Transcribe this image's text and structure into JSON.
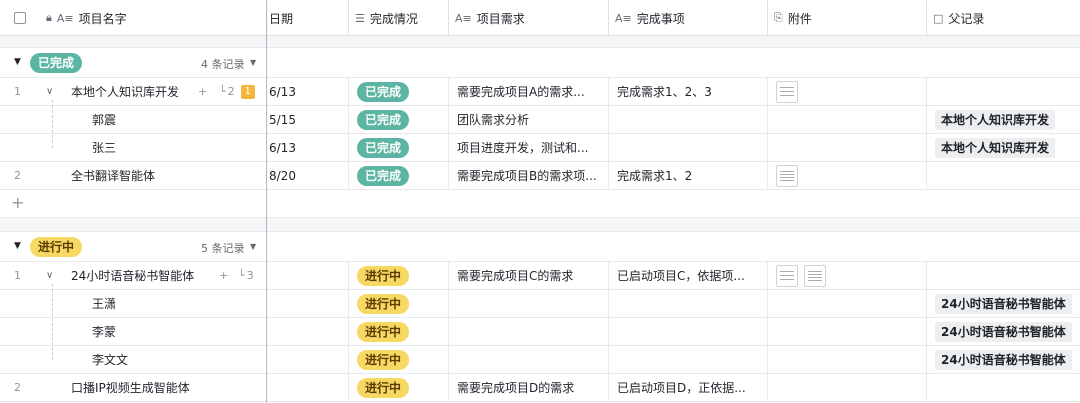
{
  "columns": {
    "name": "项目名字",
    "date": "日期",
    "status": "完成情况",
    "requirement": "项目需求",
    "done_items": "完成事项",
    "attachment": "附件",
    "parent": "父记录"
  },
  "groups": [
    {
      "label": "已完成",
      "count": "4 条记录",
      "rows": [
        {
          "num": "1",
          "name": "本地个人知识库开发",
          "sub_count": "2",
          "badge": "1",
          "date": "6/13",
          "status": "已完成",
          "requirement": "需要完成项目A的需求...",
          "done_items": "完成需求1、2、3",
          "parent": ""
        },
        {
          "num": "",
          "name": "郭震",
          "date": "5/15",
          "status": "已完成",
          "requirement": "团队需求分析",
          "done_items": "",
          "parent": "本地个人知识库开发"
        },
        {
          "num": "",
          "name": "张三",
          "date": "6/13",
          "status": "已完成",
          "requirement": "项目进度开发，测试和...",
          "done_items": "",
          "parent": "本地个人知识库开发"
        },
        {
          "num": "2",
          "name": "全书翻译智能体",
          "date": "8/20",
          "status": "已完成",
          "requirement": "需要完成项目B的需求项...",
          "done_items": "完成需求1、2",
          "parent": ""
        }
      ]
    },
    {
      "label": "进行中",
      "count": "5 条记录",
      "rows": [
        {
          "num": "1",
          "name": "24小时语音秘书智能体",
          "sub_count": "3",
          "date": "",
          "status": "进行中",
          "requirement": "需要完成项目C的需求",
          "done_items": "已启动项目C，依据项...",
          "parent": ""
        },
        {
          "num": "",
          "name": "王潇",
          "date": "",
          "status": "进行中",
          "requirement": "",
          "done_items": "",
          "parent": "24小时语音秘书智能体"
        },
        {
          "num": "",
          "name": "李蒙",
          "date": "",
          "status": "进行中",
          "requirement": "",
          "done_items": "",
          "parent": "24小时语音秘书智能体"
        },
        {
          "num": "",
          "name": "李文文",
          "date": "",
          "status": "进行中",
          "requirement": "",
          "done_items": "",
          "parent": "24小时语音秘书智能体"
        },
        {
          "num": "2",
          "name": "口播IP视频生成智能体",
          "date": "",
          "status": "进行中",
          "requirement": "需要完成项目D的需求",
          "done_items": "已启动项目D，正依据...",
          "parent": ""
        }
      ]
    }
  ],
  "add_row_symbol": "+",
  "colors": {
    "done": "#5bb5a2",
    "in_progress": "#f6d863",
    "badge": "#f4b53c"
  }
}
